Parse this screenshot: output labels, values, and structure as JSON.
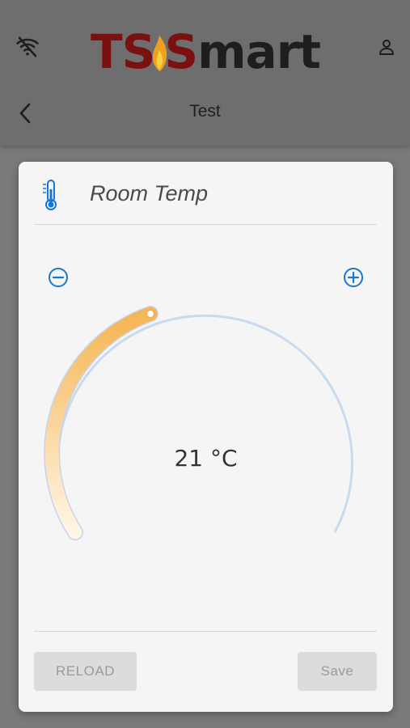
{
  "app": {
    "logo_prefix": "TS",
    "logo_s": "S",
    "logo_suffix": "mart",
    "page_title": "Test",
    "icons": {
      "status": "wifi-off-icon",
      "account": "user-icon",
      "back": "chevron-left-icon"
    }
  },
  "card": {
    "title": "Room Temp",
    "icon": "thermometer-icon",
    "decrement_icon": "minus-circle-icon",
    "increment_icon": "plus-circle-icon",
    "temperature": 21,
    "unit": "°C",
    "temperature_display": "21 °C",
    "reload_label": "RELOAD",
    "save_label": "Save"
  },
  "colors": {
    "accent": "#1976d2",
    "logo_red": "#7a1010",
    "arc_fill": "#f5b553",
    "track": "#c8daf0"
  }
}
